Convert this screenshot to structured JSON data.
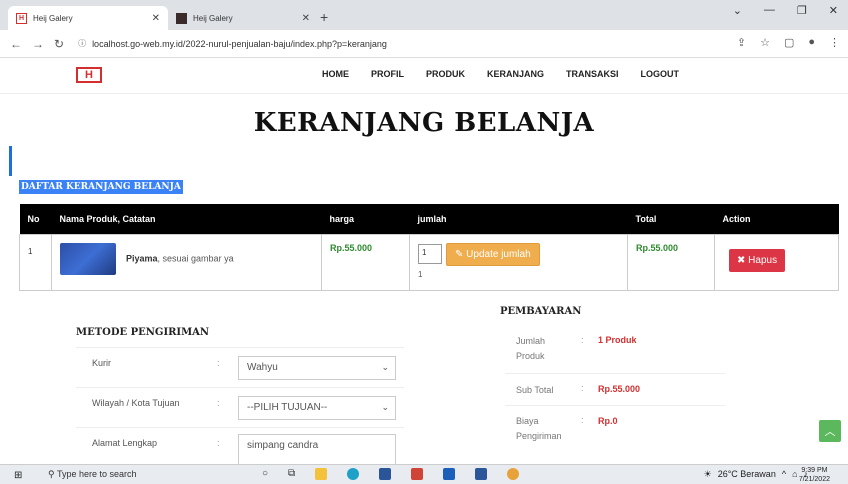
{
  "browser": {
    "tabs": [
      {
        "title": "Heij Galery",
        "active": true
      },
      {
        "title": "Heij Galery",
        "active": false
      }
    ],
    "url": "localhost.go-web.my.id/2022-nurul-penjualan-baju/index.php?p=keranjang"
  },
  "site": {
    "logo": "H",
    "menu": [
      "HOME",
      "PROFIL",
      "PRODUK",
      "KERANJANG",
      "TRANSAKSI",
      "LOGOUT"
    ]
  },
  "page": {
    "title": "KERANJANG BELANJA",
    "cart_label": "DAFTAR KERANJANG BELANJA"
  },
  "cart": {
    "headers": [
      "No",
      "Nama Produk, Catatan",
      "harga",
      "jumlah",
      "Total",
      "Action"
    ],
    "rows": [
      {
        "no": "1",
        "product": "Piyama",
        "note": ", sesuai gambar ya",
        "price": "Rp.55.000",
        "qty_input": "1",
        "qty_text": "1",
        "update_label": "Update jumlah",
        "total": "Rp.55.000",
        "delete_label": "Hapus"
      }
    ]
  },
  "shipping": {
    "title": "METODE PENGIRIMAN",
    "rows": [
      {
        "label": "Kurir",
        "value": "Wahyu"
      },
      {
        "label": "Wilayah / Kota Tujuan",
        "value": "--PILIH TUJUAN--"
      },
      {
        "label": "Alamat Lengkap",
        "value": "simpang candra"
      }
    ]
  },
  "payment": {
    "title": "PEMBAYARAN",
    "rows": [
      {
        "label": "Jumlah Produk",
        "value": "1 Produk"
      },
      {
        "label": "Sub Total",
        "value": "Rp.55.000"
      },
      {
        "label": "Biaya Pengiriman",
        "value": "Rp.0"
      }
    ]
  },
  "taskbar": {
    "search_placeholder": "Type here to search",
    "weather": "26°C Berawan",
    "time": "9:39 PM",
    "date": "7/21/2022"
  },
  "colors": {
    "accent_blue": "#3b82f6",
    "price_green": "#2e8b2e",
    "danger": "#dc3545",
    "warning": "#f0ad4e"
  }
}
